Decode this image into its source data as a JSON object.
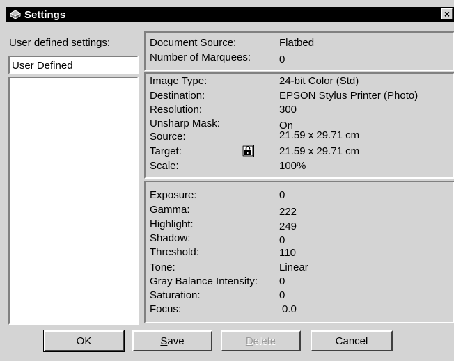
{
  "window": {
    "title": "Settings",
    "close_label": "×"
  },
  "user_settings": {
    "label_first": "U",
    "label_rest": "ser defined settings:",
    "selected_value": "User Defined"
  },
  "panel_source": [
    {
      "label": "Document Source:",
      "value": "Flatbed"
    },
    {
      "label": "Number of Marquees:",
      "value": "0"
    }
  ],
  "panel_image": [
    {
      "label": "Image Type:",
      "value": "24-bit Color (Std)"
    },
    {
      "label": "Destination:",
      "value": "EPSON Stylus Printer (Photo)"
    },
    {
      "label": "Resolution:",
      "value": "300"
    },
    {
      "label": "Unsharp Mask:",
      "value": "On"
    },
    {
      "label": "Source:",
      "value": "21.59 x 29.71 cm"
    },
    {
      "label": "Target:",
      "value": "21.59 x 29.71 cm"
    },
    {
      "label": "Scale:",
      "value": "100%"
    }
  ],
  "panel_adjust": [
    {
      "label": "Exposure:",
      "value": "0"
    },
    {
      "label": "Gamma:",
      "value": "222"
    },
    {
      "label": "Highlight:",
      "value": "249"
    },
    {
      "label": "Shadow:",
      "value": "0"
    },
    {
      "label": "Threshold:",
      "value": "110"
    },
    {
      "label": "Tone:",
      "value": "Linear"
    },
    {
      "label": "Gray Balance Intensity:",
      "value": "0"
    },
    {
      "label": "Saturation:",
      "value": "0"
    },
    {
      "label": "Focus:",
      "value": "0.0"
    }
  ],
  "buttons": {
    "ok": "OK",
    "save_first": "S",
    "save_rest": "ave",
    "delete_first": "D",
    "delete_rest": "elete",
    "cancel": "Cancel"
  },
  "icons": {
    "app": "scanner-icon",
    "lock": "lock-open-icon"
  }
}
